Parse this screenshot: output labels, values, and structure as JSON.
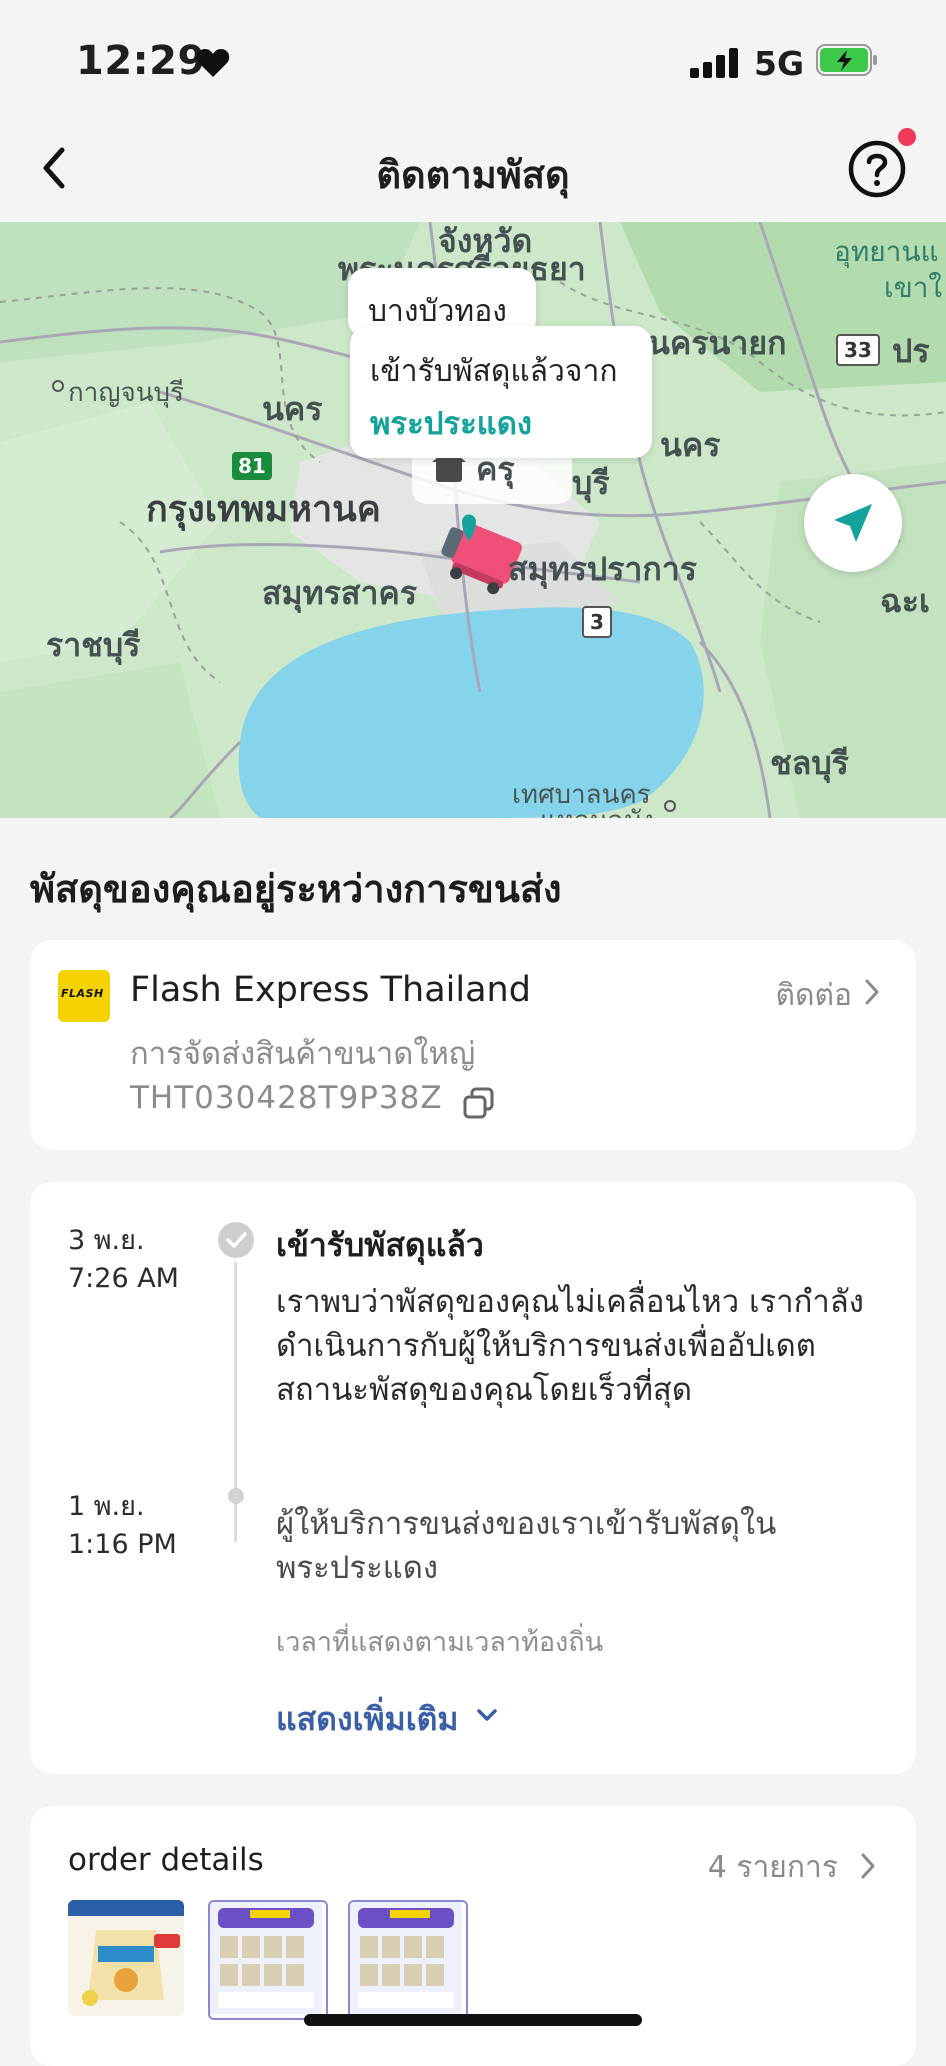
{
  "status_bar": {
    "time": "12:29",
    "network": "5G"
  },
  "nav": {
    "title": "ติดตามพัสดุ"
  },
  "map": {
    "labels": {
      "province_top": "จังหวัด",
      "ayutthaya": "พระนครศรีอยุธยา",
      "nakhon_nayok": "นครนายก",
      "park": "อุทยานแ",
      "park2": "เขาใ",
      "pra": "ปร",
      "kanchanaburi": "กาญจนบุรี",
      "nakhon": "นคร",
      "nakhon_right": "นคร",
      "bangkok": "กรุงเทพมหานค",
      "buri": "บุรี",
      "samut_sakhon": "สมุทรสาคร",
      "samut_prakan": "สมุทรปราการ",
      "chachoengsao": "ฉะเ",
      "ratchaburi": "ราชบุรี",
      "chonburi": "ชลบุรี",
      "thesaban": "เทศบาลนคร",
      "thesaban2": "แหลมฉบัง",
      "marker_label": "ครุ",
      "road_81": "81",
      "road_33": "33",
      "road_3": "3"
    },
    "bubble_location": "บางบัวทอง",
    "bubble_status": "เข้ารับพัสดุแล้วจาก",
    "bubble_place": "พระประแดง"
  },
  "section_title": "พัสดุของคุณอยู่ระหว่างการขนส่ง",
  "courier": {
    "logo_text": "FLASH",
    "name": "Flash Express Thailand",
    "contact_label": "ติดต่อ",
    "service": "การจัดส่งสินค้าขนาดใหญ่",
    "tracking_number": "THT030428T9P38Z"
  },
  "timeline": {
    "events": [
      {
        "date": "3 พ.ย.",
        "time": "7:26 AM",
        "title": "เข้ารับพัสดุแล้ว",
        "description": "เราพบว่าพัสดุของคุณไม่เคลื่อนไหว เรากำลังดำเนินการกับผู้ให้บริการขนส่งเพื่ออัปเดตสถานะพัสดุของคุณโดยเร็วที่สุด"
      },
      {
        "date": "1 พ.ย.",
        "time": "1:16 PM",
        "description": "ผู้ให้บริการขนส่งของเราเข้ารับพัสดุในพระประแดง"
      }
    ],
    "note": "เวลาที่แสดงตามเวลาท้องถิ่น",
    "show_more": "แสดงเพิ่มเติม"
  },
  "order": {
    "title": "order details",
    "count": "4 รายการ"
  },
  "colors": {
    "accent_teal": "#13a39c",
    "link_blue": "#3a5fa8",
    "notification_red": "#ef3b57",
    "flash_yellow": "#f5d300",
    "truck_pink": "#ef4f78"
  }
}
